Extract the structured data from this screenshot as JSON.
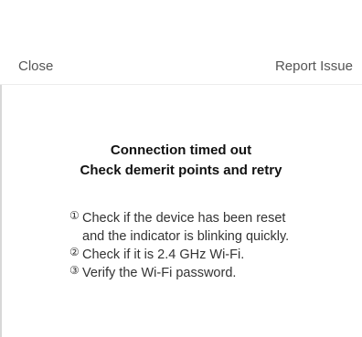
{
  "header": {
    "close_label": "Close",
    "report_label": "Report Issue"
  },
  "message": {
    "title_line1": "Connection timed out",
    "title_line2": "Check demerit points and retry"
  },
  "steps": [
    {
      "number": "①",
      "text": "Check if the device has been reset and the indicator is blinking quickly."
    },
    {
      "number": "②",
      "text": "Check if it is 2.4 GHz Wi-Fi."
    },
    {
      "number": "③",
      "text": "Verify the Wi-Fi password."
    }
  ]
}
